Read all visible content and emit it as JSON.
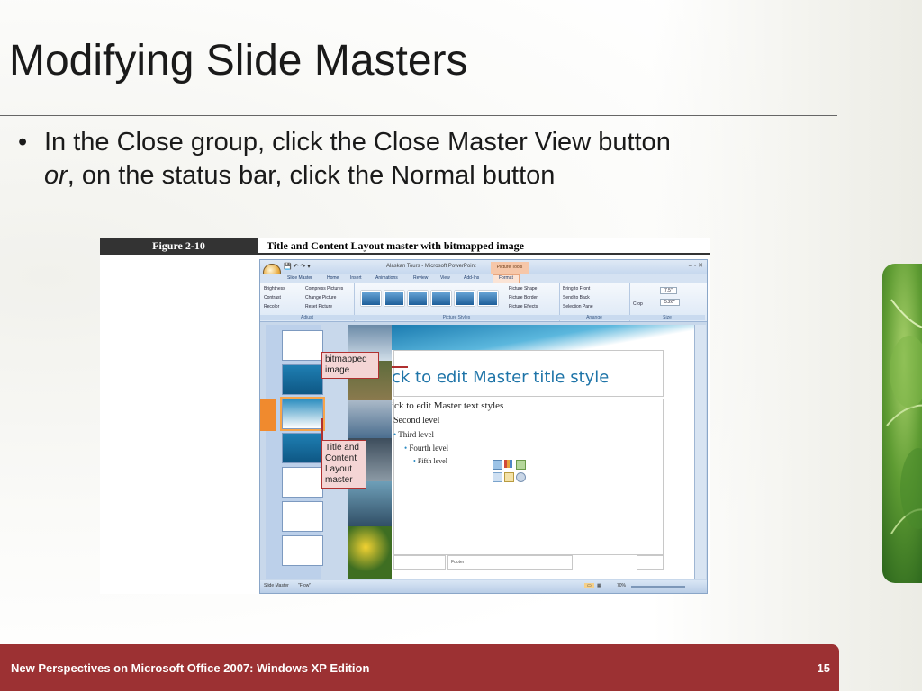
{
  "slide": {
    "title": "Modifying Slide Masters",
    "bullet_part1": "In the Close group, click the Close Master View button",
    "bullet_or": "or",
    "bullet_part2": ", on the status bar, click the Normal button"
  },
  "figure": {
    "number": "Figure  2-10",
    "caption": "Title and Content Layout master with bitmapped image"
  },
  "ppt": {
    "window_title": "Alaskan Tours - Microsoft PowerPoint",
    "contextual_tab": "Picture Tools",
    "tabs": [
      "Slide Master",
      "Home",
      "Insert",
      "Animations",
      "Review",
      "View",
      "Add-Ins",
      "Format"
    ],
    "adjust": {
      "label": "Adjust",
      "items": [
        "Brightness",
        "Contrast",
        "Recolor",
        "Compress Pictures",
        "Change Picture",
        "Reset Picture"
      ]
    },
    "picture_styles": {
      "label": "Picture Styles",
      "items": [
        "Picture Shape",
        "Picture Border",
        "Picture Effects"
      ]
    },
    "arrange": {
      "label": "Arrange",
      "items": [
        "Bring to Front",
        "Send to Back",
        "Selection Pane"
      ]
    },
    "size": {
      "label": "Size",
      "crop": "Crop",
      "height": "7.5\"",
      "width": "5.26\""
    },
    "master": {
      "title": "ck to edit Master title style",
      "body_level1": "ick to edit Master text styles",
      "level2": "Second level",
      "level3": "Third level",
      "level4": "Fourth level",
      "level5": "Fifth level",
      "footer": "Footer"
    },
    "status": {
      "view": "Slide Master",
      "theme": "\"Flow\"",
      "zoom": "70%"
    }
  },
  "callouts": {
    "bitmapped": "bitmapped image",
    "layout": "Title and Content Layout master"
  },
  "footer": {
    "text": "New Perspectives on Microsoft Office 2007: Windows XP Edition",
    "page": "15"
  },
  "colors": {
    "footer_bg": "#9c3133",
    "callout_border": "#b03030",
    "slide_title": "#1e74a8"
  }
}
